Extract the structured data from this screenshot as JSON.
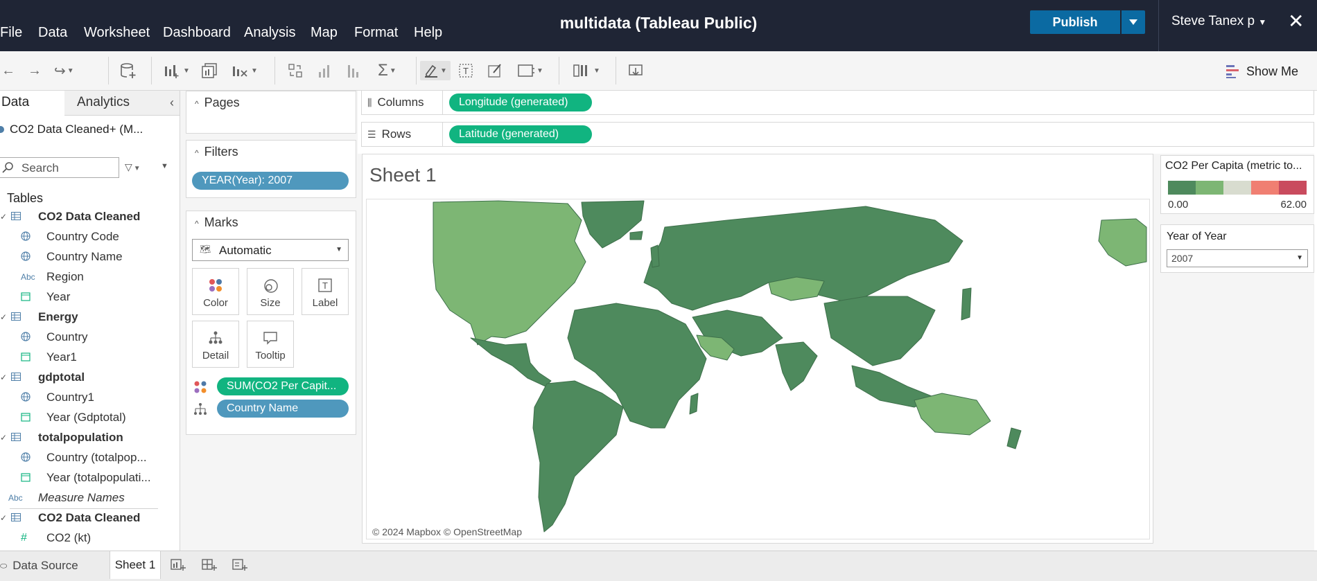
{
  "menu": [
    "File",
    "Data",
    "Worksheet",
    "Dashboard",
    "Analysis",
    "Map",
    "Format",
    "Help"
  ],
  "app_title": "multidata (Tableau Public)",
  "publish_label": "Publish",
  "user_name": "Steve Tanex p",
  "show_me_label": "Show Me",
  "left_tabs": {
    "data": "Data",
    "analytics": "Analytics"
  },
  "datasource_name": "CO2 Data Cleaned+ (M...",
  "search_placeholder": "Search",
  "tables_heading": "Tables",
  "fields": [
    {
      "label": "CO2 Data Cleaned",
      "type": "table"
    },
    {
      "label": "Country Code",
      "type": "geo"
    },
    {
      "label": "Country Name",
      "type": "geo"
    },
    {
      "label": "Region",
      "type": "abc"
    },
    {
      "label": "Year",
      "type": "date"
    },
    {
      "label": "Energy",
      "type": "table"
    },
    {
      "label": "Country",
      "type": "geo"
    },
    {
      "label": "Year1",
      "type": "date"
    },
    {
      "label": "gdptotal",
      "type": "table"
    },
    {
      "label": "Country1",
      "type": "geo"
    },
    {
      "label": "Year (Gdptotal)",
      "type": "date"
    },
    {
      "label": "totalpopulation",
      "type": "table"
    },
    {
      "label": "Country (totalpop...",
      "type": "geo"
    },
    {
      "label": "Year (totalpopulati...",
      "type": "date"
    },
    {
      "label": "Measure Names",
      "type": "abc-italic"
    },
    {
      "label": "CO2 Data Cleaned",
      "type": "table"
    },
    {
      "label": "CO2 (kt)",
      "type": "measure"
    }
  ],
  "icon_text": {
    "abc": "Abc",
    "measure": "#"
  },
  "pages_title": "Pages",
  "filters_title": "Filters",
  "filter_pill": "YEAR(Year): 2007",
  "marks_title": "Marks",
  "marks_type": "Automatic",
  "mark_buttons": [
    "Color",
    "Size",
    "Label",
    "Detail",
    "Tooltip"
  ],
  "marks_pills": [
    "SUM(CO2 Per Capit...",
    "Country Name"
  ],
  "columns_label": "Columns",
  "rows_label": "Rows",
  "columns_pill": "Longitude (generated)",
  "rows_pill": "Latitude (generated)",
  "sheet_title": "Sheet 1",
  "map_credit": "© 2024 Mapbox  © OpenStreetMap",
  "legend": {
    "title": "CO2 Per Capita (metric to...",
    "min": "0.00",
    "max": "62.00",
    "colors": [
      "#4e8a5d",
      "#7db674",
      "#d8dccf",
      "#f07f72",
      "#c94b5e"
    ]
  },
  "year_filter": {
    "title": "Year of Year",
    "value": "2007"
  },
  "bottom_tabs": {
    "data_source": "Data Source",
    "sheet": "Sheet 1"
  },
  "map_colors": {
    "dark": "#4e8a5d",
    "light": "#7db674",
    "border": "#3d6f4a"
  }
}
